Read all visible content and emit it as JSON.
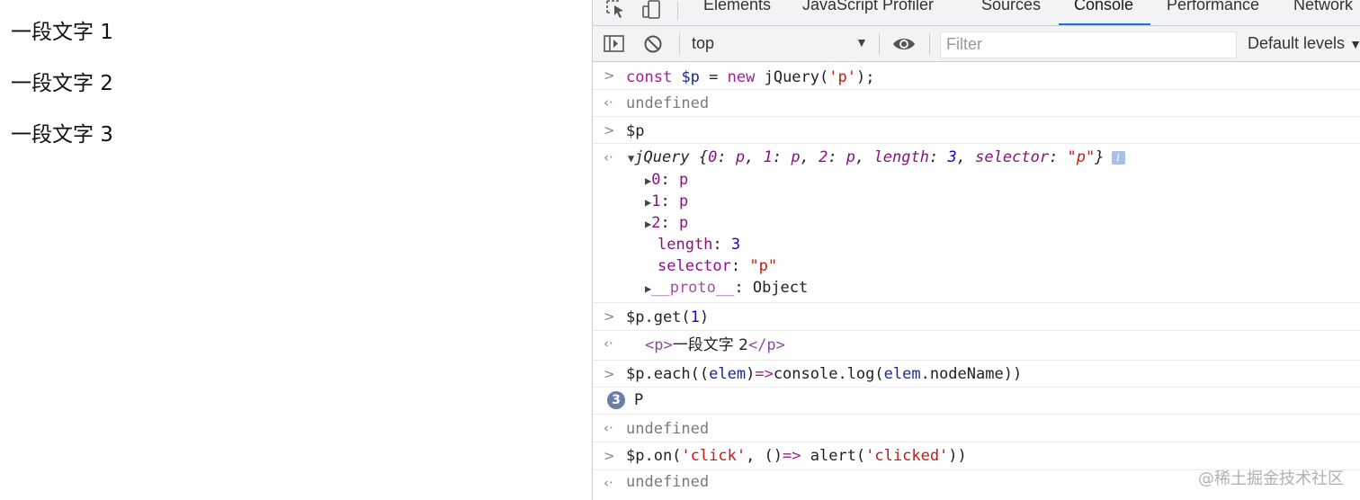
{
  "page": {
    "paragraphs": [
      "一段文字 1",
      "一段文字 2",
      "一段文字 3"
    ]
  },
  "devtools": {
    "tabs": [
      {
        "label": "Elements",
        "active": false
      },
      {
        "label": "JavaScript Profiler",
        "active": false
      },
      {
        "label": "Sources",
        "active": false
      },
      {
        "label": "Console",
        "active": true
      },
      {
        "label": "Performance",
        "active": false
      },
      {
        "label": "Network",
        "active": false
      }
    ],
    "toolbar": {
      "context": "top",
      "filter_placeholder": "Filter",
      "levels": "Default levels"
    },
    "console": {
      "cmd1": {
        "kw": "const",
        "var": "$p",
        "op": " = ",
        "kw2": "new",
        "call": " jQuery(",
        "arg": "'p'",
        "end": ");"
      },
      "res1": "undefined",
      "cmd2": "$p",
      "obj": {
        "head": "jQuery {",
        "k0": "0",
        "v0": "p",
        "k1": "1",
        "v1": "p",
        "k2": "2",
        "v2": "p",
        "klen": "length",
        "vlen": "3",
        "ksel": "selector",
        "vsel": "\"p\"",
        "close": "}",
        "info": "i"
      },
      "entries": [
        {
          "key": "0",
          "value": "p"
        },
        {
          "key": "1",
          "value": "p"
        },
        {
          "key": "2",
          "value": "p"
        }
      ],
      "length": {
        "key": "length",
        "value": "3"
      },
      "selector": {
        "key": "selector",
        "value": "\"p\""
      },
      "proto": {
        "key": "__proto__",
        "value": "Object"
      },
      "cmd3": {
        "obj": "$p.get(",
        "num": "1",
        "end": ")"
      },
      "res3": {
        "open": "<p>",
        "text": "一段文字 2",
        "close": "</p>"
      },
      "cmd4": {
        "a": "$p.each((",
        "arg": "elem",
        "b": ")",
        "arrow": "=>",
        "c": "console.log(",
        "arg2": "elem",
        "d": ".nodeName))"
      },
      "log4": {
        "count": "3",
        "text": "P"
      },
      "res4": "undefined",
      "cmd5": {
        "a": "$p.on(",
        "s1": "'click'",
        "b": ", ()",
        "arrow": "=>",
        "c": " alert(",
        "s2": "'clicked'",
        "d": "))"
      },
      "res5": "undefined"
    }
  },
  "watermark": "@稀土掘金技术社区"
}
